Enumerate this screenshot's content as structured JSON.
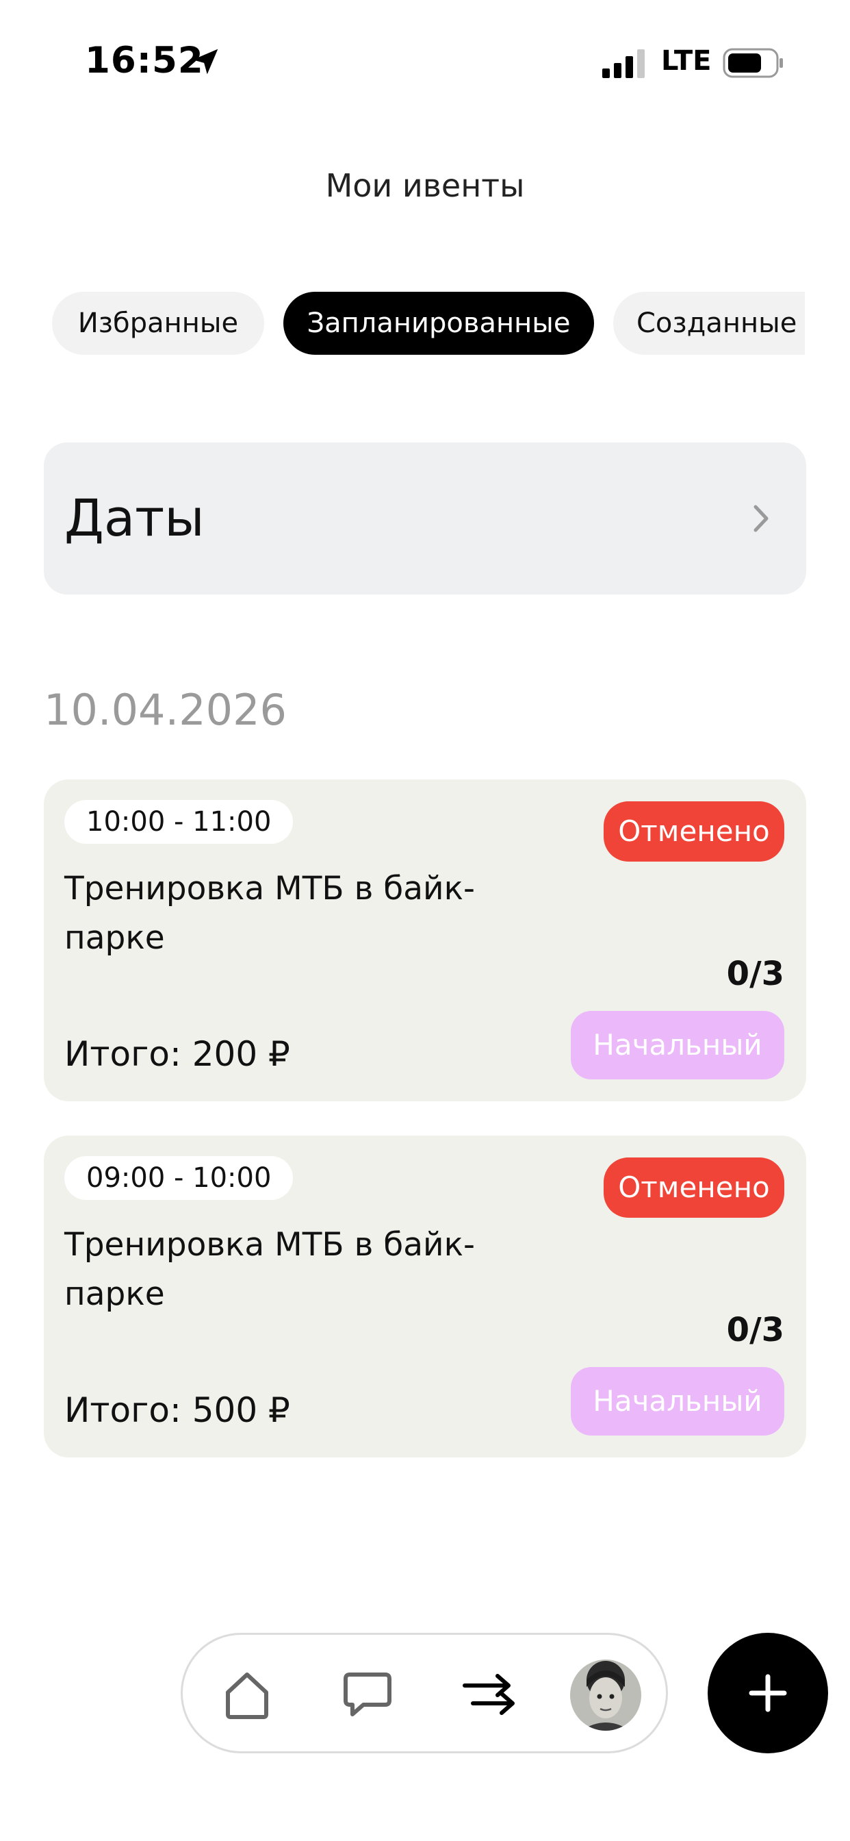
{
  "status_bar": {
    "time": "16:52",
    "network": "LTE",
    "icons": [
      "location-arrow-icon",
      "signal-icon",
      "battery-icon"
    ]
  },
  "header": {
    "title": "Мои ивенты"
  },
  "tabs": [
    {
      "label": "Избранные",
      "active": false
    },
    {
      "label": "Запланированные",
      "active": true
    },
    {
      "label": "Созданные",
      "active": false
    }
  ],
  "dates_filter": {
    "label": "Даты",
    "icon": "chevron-right-icon"
  },
  "date_group": {
    "date": "10.04.2026"
  },
  "events": [
    {
      "time": "10:00 - 11:00",
      "status": "Отменено",
      "title": "Тренировка МТБ в байк-парке",
      "participants": "0/3",
      "total": "Итого: 200 ₽",
      "level": "Начальный"
    },
    {
      "time": "09:00 - 10:00",
      "status": "Отменено",
      "title": "Тренировка МТБ в байк-парке",
      "participants": "0/3",
      "total": "Итого: 500 ₽",
      "level": "Начальный"
    }
  ],
  "bottom_nav": {
    "items": [
      "home-icon",
      "chat-icon",
      "transfer-arrows-icon",
      "avatar"
    ],
    "fab": "plus-icon"
  },
  "colors": {
    "accent_black": "#000000",
    "status_cancelled": "#f04438",
    "level_badge": "#ebb8fa",
    "card_background": "#f1f1ec",
    "filter_background": "#eff0f2",
    "date_heading": "#9a9a9a"
  }
}
